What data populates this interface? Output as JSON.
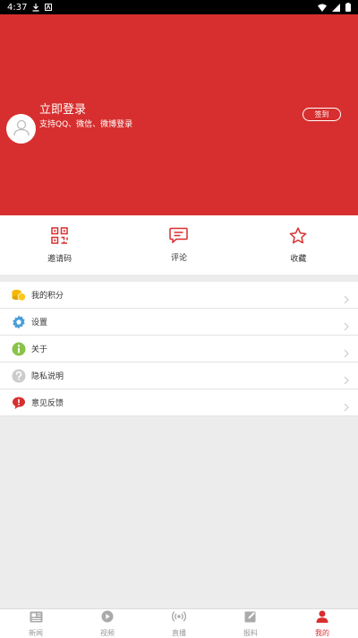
{
  "status_bar": {
    "time": "4:37"
  },
  "header": {
    "login_title": "立即登录",
    "login_subtitle": "支持QQ、微信、微博登录",
    "sign_in_label": "签到",
    "bg_color": "#d72f2f"
  },
  "quick_actions": [
    {
      "label": "邀请码",
      "icon": "qr-code-icon"
    },
    {
      "label": "评论",
      "icon": "comment-icon"
    },
    {
      "label": "收藏",
      "icon": "star-icon"
    }
  ],
  "menu": [
    {
      "label": "我的积分",
      "icon": "coins-icon",
      "color": "#f5b800"
    },
    {
      "label": "设置",
      "icon": "gear-icon",
      "color": "#4a9fd8"
    },
    {
      "label": "关于",
      "icon": "info-icon",
      "color": "#8bc34a"
    },
    {
      "label": "隐私说明",
      "icon": "question-icon",
      "color": "#cccccc"
    },
    {
      "label": "意见反馈",
      "icon": "feedback-icon",
      "color": "#d72f2f"
    }
  ],
  "tabbar": [
    {
      "label": "新闻",
      "icon": "news-icon"
    },
    {
      "label": "视频",
      "icon": "video-icon"
    },
    {
      "label": "直播",
      "icon": "live-icon"
    },
    {
      "label": "报料",
      "icon": "report-icon"
    },
    {
      "label": "我的",
      "icon": "profile-icon",
      "active": true
    }
  ]
}
